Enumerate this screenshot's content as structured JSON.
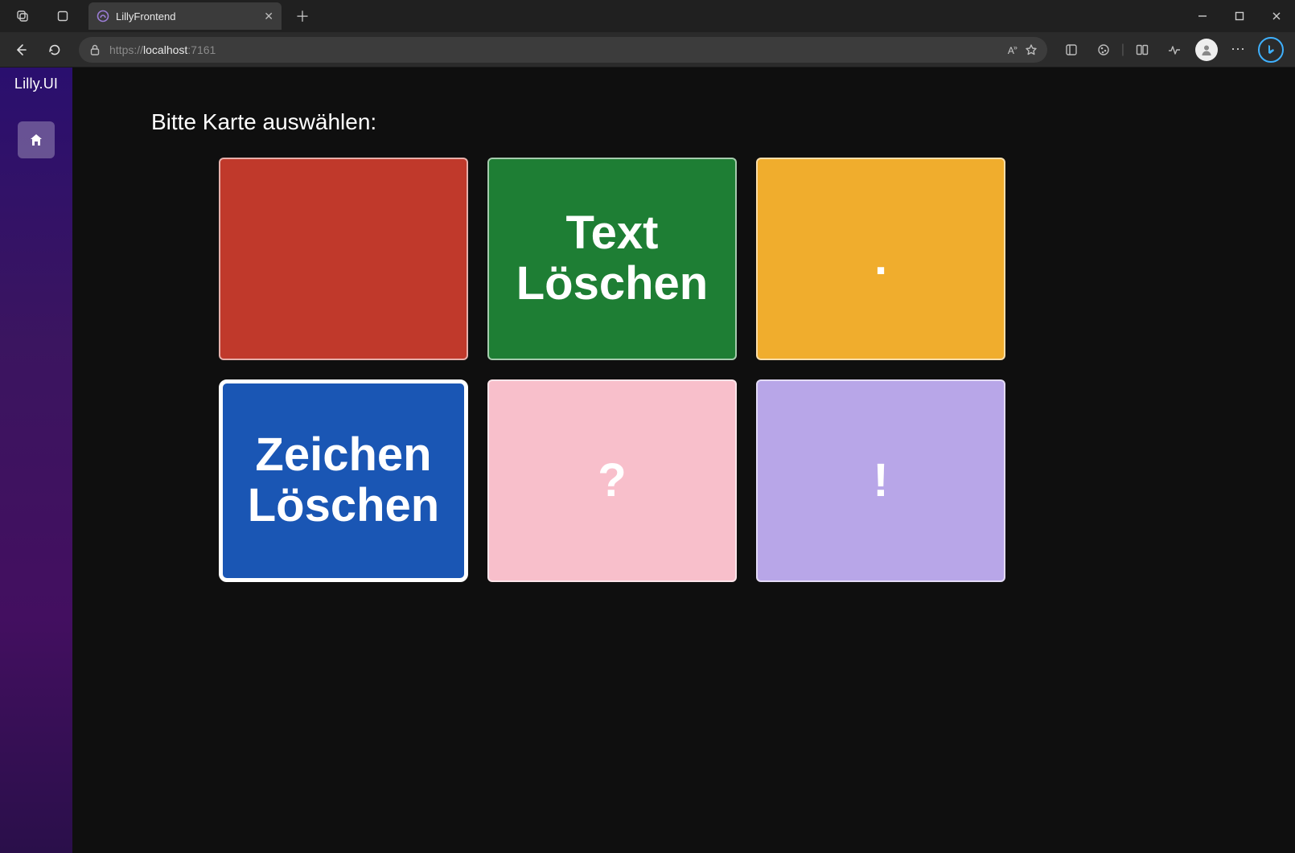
{
  "browser": {
    "tab_title": "LillyFrontend",
    "url_scheme": "https://",
    "url_host": "localhost",
    "url_port": ":7161"
  },
  "sidebar": {
    "brand": "Lilly.UI"
  },
  "page": {
    "heading": "Bitte Karte auswählen:"
  },
  "cards": [
    {
      "id": "card-empty-red",
      "label": "",
      "color": "#c0392b",
      "selected": false
    },
    {
      "id": "card-text-loeschen",
      "label": "Text\nLöschen",
      "color": "#1e7e34",
      "selected": false
    },
    {
      "id": "card-period",
      "label": ".",
      "color": "#f0ad2d",
      "selected": false
    },
    {
      "id": "card-zeichen-loeschen",
      "label": "Zeichen\nLöschen",
      "color": "#1a56b4",
      "selected": true
    },
    {
      "id": "card-question",
      "label": "?",
      "color": "#f8bfcb",
      "selected": false
    },
    {
      "id": "card-exclaim",
      "label": "!",
      "color": "#b8a6e8",
      "selected": false
    }
  ]
}
